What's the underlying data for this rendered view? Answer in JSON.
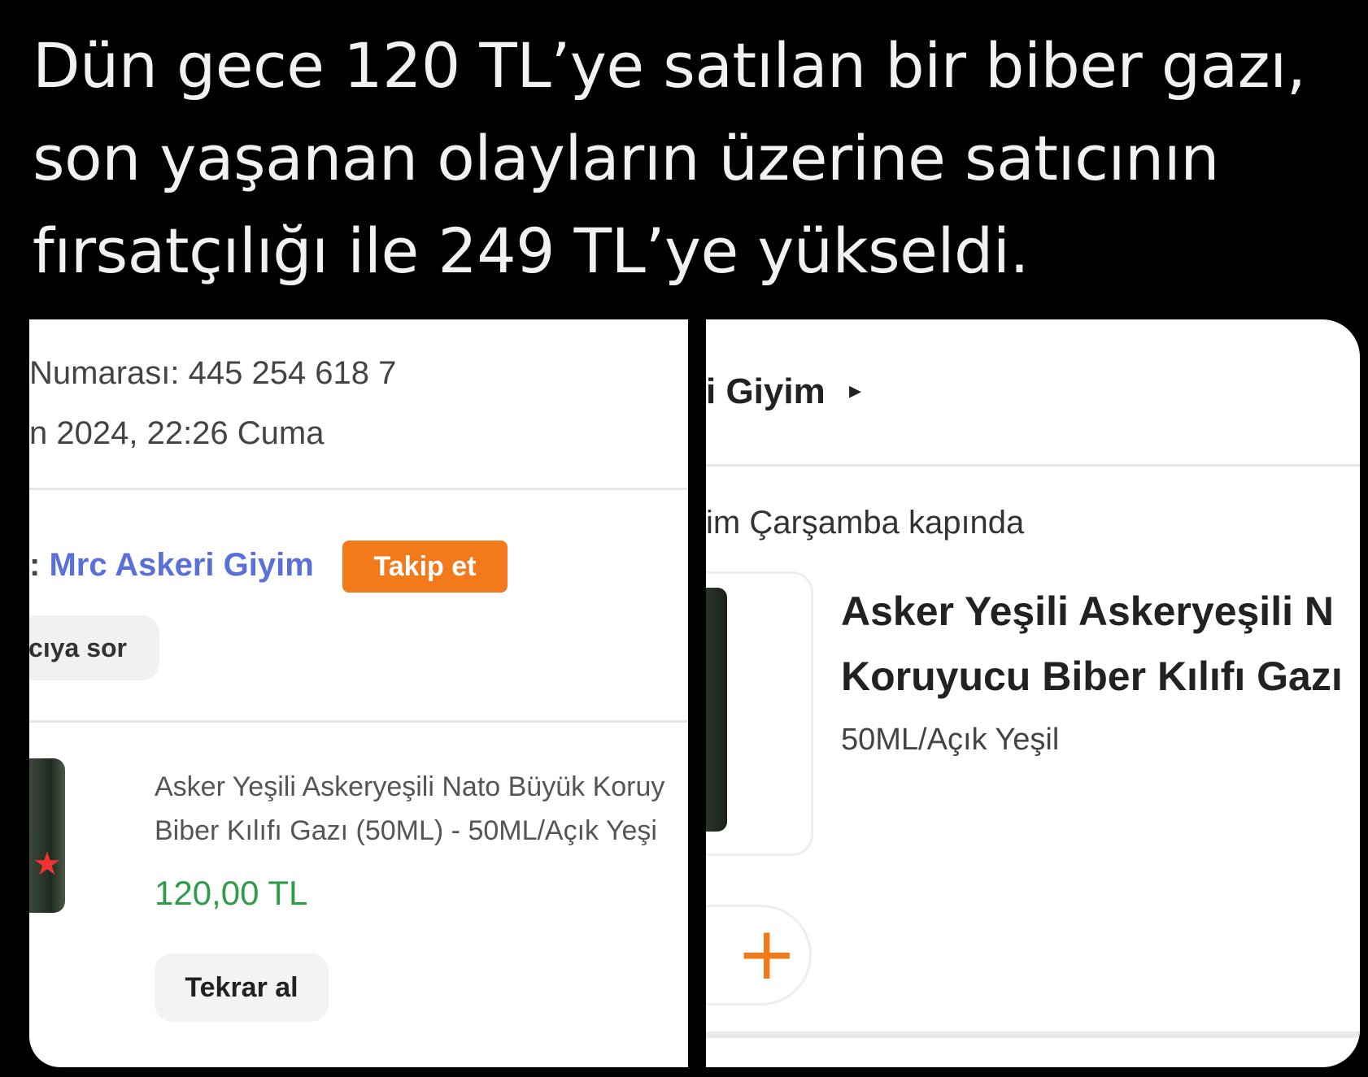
{
  "tweet": {
    "line1": "Dün gece 120 TL’ye satılan bir biber gazı,",
    "line2": "son yaşanan olayların üzerine satıcının",
    "line3": "fırsatçılığı ile 249 TL’ye yükseldi."
  },
  "left_screenshot": {
    "order_number": "Numarası: 445 254 618 7",
    "order_date": "n 2024, 22:26 Cuma",
    "seller_prefix": ": ",
    "seller_name": "Mrc Askeri Giyim",
    "follow_button": "Takip et",
    "ask_seller_button": "cıya sor",
    "product_title_line1": "Asker Yeşili Askeryeşili Nato Büyük Koruy",
    "product_title_line2": "Biber Kılıfı Gazı (50ML) - 50ML/Açık Yeşi",
    "price": "120,00 TL",
    "buy_again_button": "Tekrar al"
  },
  "right_screenshot": {
    "store_name": "i Giyim",
    "store_arrow": "▸",
    "delivery": "im Çarşamba kapında",
    "product_title_line1": "Asker Yeşili Askeryeşili N",
    "product_title_line2": "Koruyucu Biber Kılıfı Gazı",
    "variant": "50ML/Açık Yeşil",
    "add_button": "+"
  },
  "colors": {
    "accent_orange": "#f27a1a",
    "price_green": "#2f9c4a",
    "seller_link_blue": "#5a6fd8"
  }
}
